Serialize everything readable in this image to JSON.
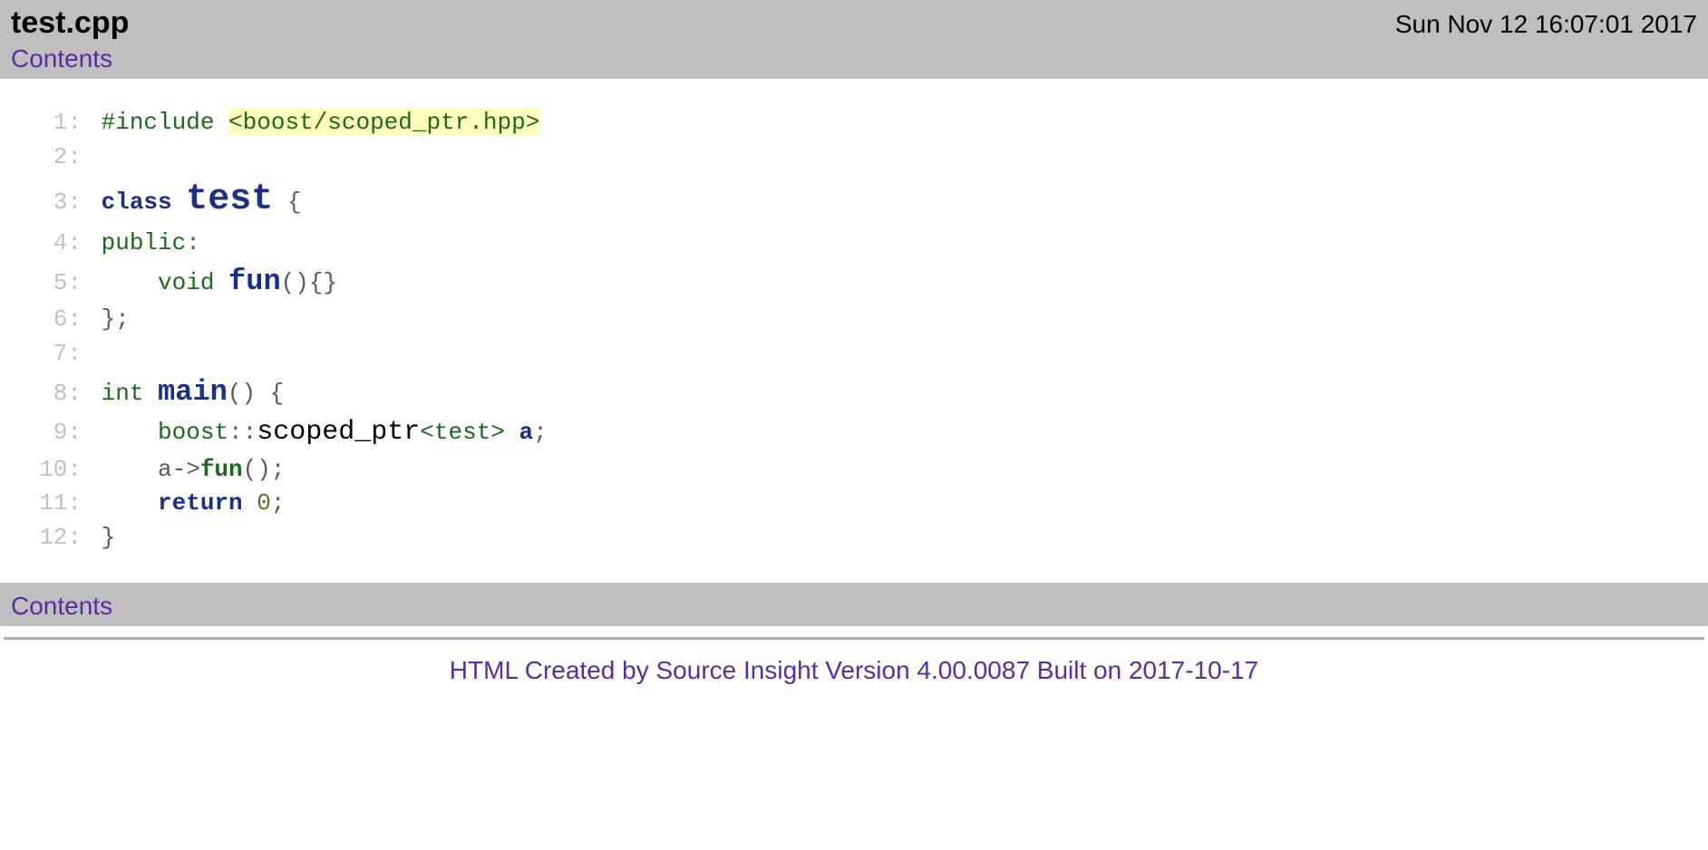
{
  "header": {
    "filename": "test.cpp",
    "timestamp": "Sun Nov 12 16:07:01 2017",
    "contents_label": "Contents"
  },
  "code": {
    "lines": [
      {
        "n": "1:",
        "tokens": [
          {
            "cls": "tok-preproc",
            "t": "#include "
          },
          {
            "cls": "tok-include-path",
            "t": "<boost/scoped_ptr.hpp>"
          }
        ]
      },
      {
        "n": "2:",
        "tokens": []
      },
      {
        "n": "3:",
        "tokens": [
          {
            "cls": "tok-keyword",
            "t": "class "
          },
          {
            "cls": "tok-classname",
            "t": "test"
          },
          {
            "cls": "tok-punct",
            "t": " {"
          }
        ]
      },
      {
        "n": "4:",
        "tokens": [
          {
            "cls": "tok-type",
            "t": "public"
          },
          {
            "cls": "tok-punct",
            "t": ":"
          }
        ]
      },
      {
        "n": "5:",
        "tokens": [
          {
            "cls": "tok-plain",
            "t": "    "
          },
          {
            "cls": "tok-type",
            "t": "void "
          },
          {
            "cls": "tok-funcdef",
            "t": "fun"
          },
          {
            "cls": "tok-punct",
            "t": "(){}"
          }
        ]
      },
      {
        "n": "6:",
        "tokens": [
          {
            "cls": "tok-punct",
            "t": "};"
          }
        ]
      },
      {
        "n": "7:",
        "tokens": []
      },
      {
        "n": "8:",
        "tokens": [
          {
            "cls": "tok-type",
            "t": "int "
          },
          {
            "cls": "tok-funcdef",
            "t": "main"
          },
          {
            "cls": "tok-punct",
            "t": "() {"
          }
        ]
      },
      {
        "n": "9:",
        "tokens": [
          {
            "cls": "tok-plain",
            "t": "    "
          },
          {
            "cls": "tok-ns",
            "t": "boost"
          },
          {
            "cls": "tok-punct",
            "t": "::"
          },
          {
            "cls": "tok-nstype",
            "t": "scoped_ptr"
          },
          {
            "cls": "tok-tmpl",
            "t": "<test>"
          },
          {
            "cls": "tok-plain",
            "t": " "
          },
          {
            "cls": "tok-ident",
            "t": "a"
          },
          {
            "cls": "tok-punct",
            "t": ";"
          }
        ]
      },
      {
        "n": "10:",
        "tokens": [
          {
            "cls": "tok-plain",
            "t": "    a->"
          },
          {
            "cls": "tok-funcref",
            "t": "fun"
          },
          {
            "cls": "tok-punct",
            "t": "();"
          }
        ]
      },
      {
        "n": "11:",
        "tokens": [
          {
            "cls": "tok-plain",
            "t": "    "
          },
          {
            "cls": "tok-keyword",
            "t": "return"
          },
          {
            "cls": "tok-plain",
            "t": " "
          },
          {
            "cls": "tok-num",
            "t": "0"
          },
          {
            "cls": "tok-punct",
            "t": ";"
          }
        ]
      },
      {
        "n": "12:",
        "tokens": [
          {
            "cls": "tok-punct",
            "t": "}"
          }
        ]
      }
    ]
  },
  "footer": {
    "contents_label": "Contents",
    "generated": "HTML Created by Source Insight Version 4.00.0087 Built on 2017-10-17"
  }
}
